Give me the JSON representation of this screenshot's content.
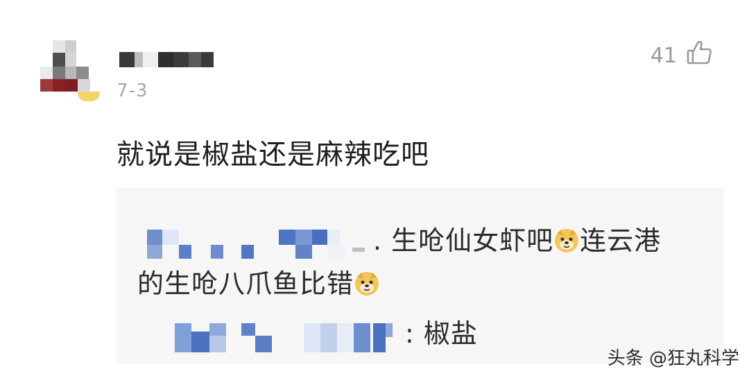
{
  "comment": {
    "date": "7-3",
    "like_count": "41",
    "text": "就说是椒盐还是麻辣吃吧"
  },
  "reply_thread": {
    "reply_1_part_a": ". 生呛仙女虾吧",
    "reply_1_part_b": "连云港",
    "reply_1_line_2": "的生呛八爪鱼比错",
    "reply_2_text": ": 椒盐"
  },
  "watermark": "头条 @狂丸科学",
  "icons": {
    "like": "thumbs-up-icon",
    "emoji": "doge-emoji-icon"
  }
}
